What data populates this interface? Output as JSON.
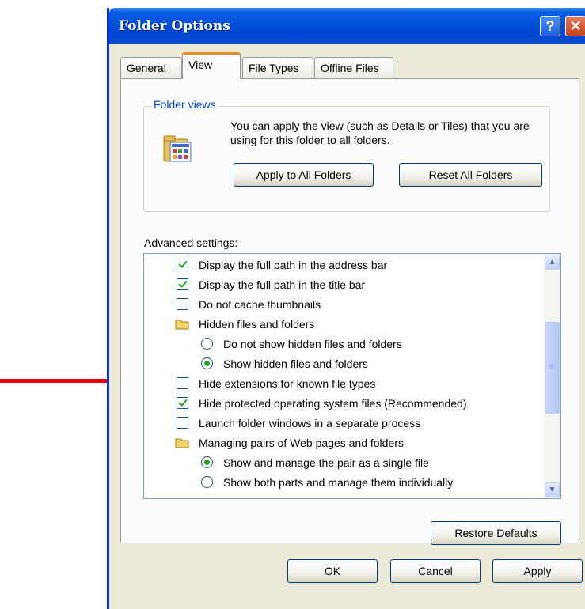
{
  "window": {
    "title": "Folder Options",
    "help_glyph": "?",
    "close_glyph": "✕"
  },
  "tabs": [
    {
      "label": "General",
      "active": false
    },
    {
      "label": "View",
      "active": true
    },
    {
      "label": "File Types",
      "active": false
    },
    {
      "label": "Offline Files",
      "active": false
    }
  ],
  "folder_views": {
    "label": "Folder views",
    "description": "You can apply the view (such as Details or Tiles) that you are using for this folder to all folders.",
    "apply_button": "Apply to All Folders",
    "reset_button": "Reset All Folders"
  },
  "advanced": {
    "label": "Advanced settings:",
    "items": [
      {
        "type": "checkbox",
        "label": "Display the full path in the address bar",
        "checked": true,
        "indent": 1
      },
      {
        "type": "checkbox",
        "label": "Display the full path in the title bar",
        "checked": true,
        "indent": 1
      },
      {
        "type": "checkbox",
        "label": "Do not cache thumbnails",
        "checked": false,
        "indent": 1
      },
      {
        "type": "folder",
        "label": "Hidden files and folders",
        "indent": 1
      },
      {
        "type": "radio",
        "label": "Do not show hidden files and folders",
        "checked": false,
        "indent": 2
      },
      {
        "type": "radio",
        "label": "Show hidden files and folders",
        "checked": true,
        "indent": 2
      },
      {
        "type": "checkbox",
        "label": "Hide extensions for known file types",
        "checked": false,
        "indent": 1
      },
      {
        "type": "checkbox",
        "label": "Hide protected operating system files (Recommended)",
        "checked": true,
        "indent": 1
      },
      {
        "type": "checkbox",
        "label": "Launch folder windows in a separate process",
        "checked": false,
        "indent": 1
      },
      {
        "type": "folder",
        "label": "Managing pairs of Web pages and folders",
        "indent": 1
      },
      {
        "type": "radio",
        "label": "Show and manage the pair as a single file",
        "checked": true,
        "indent": 2
      },
      {
        "type": "radio",
        "label": "Show both parts and manage them individually",
        "checked": false,
        "indent": 2
      }
    ],
    "restore_button": "Restore Defaults"
  },
  "footer": {
    "ok": "OK",
    "cancel": "Cancel",
    "apply": "Apply"
  },
  "colors": {
    "titlebar": "#0046d5",
    "dialog_bg": "#ece9d8",
    "arrow": "#e4000f",
    "check": "#21a121"
  }
}
